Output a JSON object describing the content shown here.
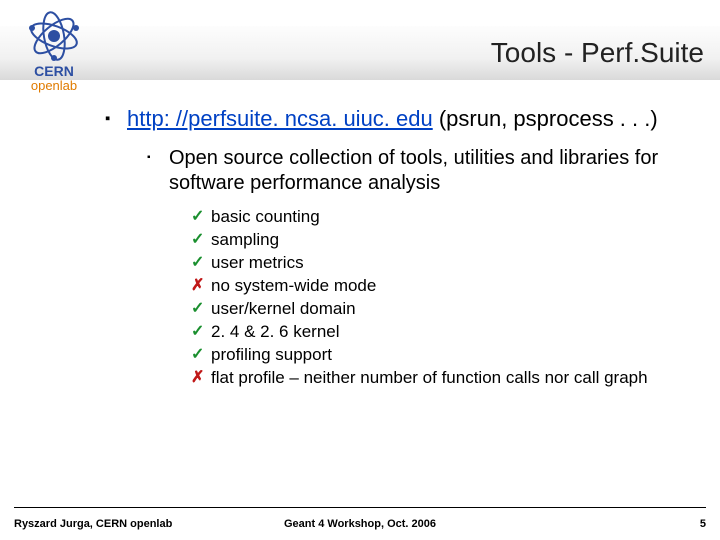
{
  "title": "Tools - Perf.Suite",
  "logo": {
    "line1": "CERN",
    "line2": "openlab"
  },
  "bullet1": {
    "link_text": "http: //perfsuite. ncsa. uiuc. edu",
    "link_href": "http://perfsuite.ncsa.uiuc.edu",
    "tail": " (psrun, psprocess . . .)"
  },
  "bullet2": "Open source collection of tools, utilities and libraries for software performance analysis",
  "features": [
    {
      "ok": true,
      "text": "basic counting"
    },
    {
      "ok": true,
      "text": "sampling"
    },
    {
      "ok": true,
      "text": "user metrics"
    },
    {
      "ok": false,
      "text": "no system-wide mode"
    },
    {
      "ok": true,
      "text": "user/kernel domain"
    },
    {
      "ok": true,
      "text": "2. 4 & 2. 6 kernel"
    },
    {
      "ok": true,
      "text": "profiling support"
    },
    {
      "ok": false,
      "text": "flat profile – neither number of function calls nor call graph"
    }
  ],
  "footer": {
    "left": "Ryszard Jurga, CERN openlab",
    "center": "Geant 4 Workshop, Oct. 2006",
    "right": "5"
  }
}
